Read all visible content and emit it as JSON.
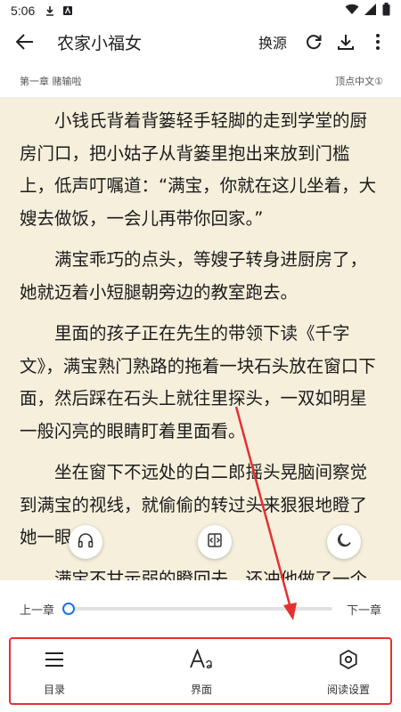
{
  "status_bar": {
    "time": "5:06"
  },
  "app_bar": {
    "title": "农家小福女",
    "source_label": "换源"
  },
  "chapter": {
    "name": "第一章 赌输啦",
    "source_site": "顶点中文①"
  },
  "content": {
    "paragraphs": [
      "小钱氏背着背篓轻手轻脚的走到学堂的厨房门口，把小姑子从背篓里抱出来放到门槛上，低声叮嘱道：“满宝，你就在这儿坐着，大嫂去做饭，一会儿再带你回家。”",
      "满宝乖巧的点头，等嫂子转身进厨房了，她就迈着小短腿朝旁边的教室跑去。",
      "里面的孩子正在先生的带领下读《千字文》，满宝熟门熟路的拖着一块石头放在窗口下面，然后踩在石头上就往里探头，一双如明星一般闪亮的眼睛盯着里面看。",
      "坐在窗下不远处的白二郎摇头晃脑间察觉到满宝的视线，就偷偷的转过头来狠狠地瞪了她一眼。",
      "满宝不甘示弱的瞪回去，还冲他做了一个"
    ]
  },
  "reading_progress": 0.0,
  "chapter_nav": {
    "prev_label": "上一章",
    "next_label": "下一章"
  },
  "bottom_menu": {
    "items": [
      {
        "label": "目录",
        "icon": "menu-list-icon"
      },
      {
        "label": "界面",
        "icon": "font-size-icon"
      },
      {
        "label": "阅读设置",
        "icon": "hexagon-settings-icon"
      }
    ]
  },
  "floating_buttons": [
    "headphones-icon",
    "auto-page-icon",
    "moon-icon"
  ],
  "colors": {
    "reading_bg": "#f6efdc",
    "accent": "#1a73e8",
    "annotation": "#e4312f"
  }
}
